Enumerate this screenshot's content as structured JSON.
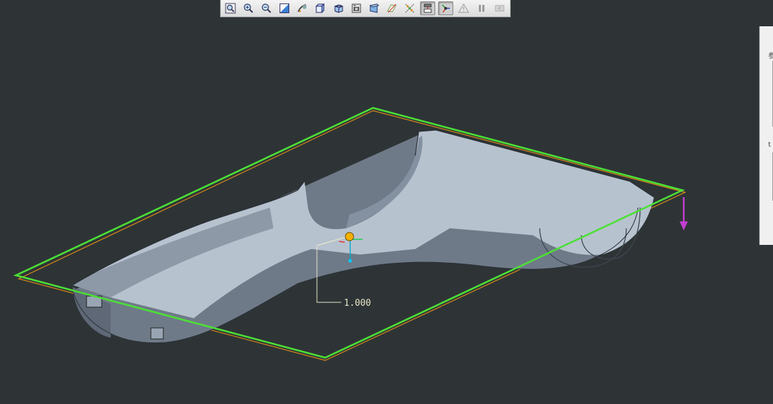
{
  "viewport": {
    "background": "#2e3436",
    "plane_outline_color": "#4ce036",
    "plane_edge_color": "#d98a1a",
    "model_color": "#a8b3c2",
    "direction_arrow_color": "#c23fd0"
  },
  "dimension": {
    "value": "1.000"
  },
  "toolbar": {
    "buttons": [
      {
        "icon": "zoom-fit-icon",
        "pressed": false
      },
      {
        "icon": "zoom-in-icon",
        "pressed": false
      },
      {
        "icon": "zoom-out-icon",
        "pressed": false
      },
      {
        "icon": "repaint-icon",
        "pressed": false
      },
      {
        "icon": "orient-mode-icon",
        "pressed": false
      },
      {
        "icon": "saved-views-icon",
        "pressed": false
      },
      {
        "icon": "display-style-icon",
        "pressed": false
      },
      {
        "icon": "view-manager-icon",
        "pressed": false
      },
      {
        "icon": "perspective-icon",
        "pressed": false
      },
      {
        "icon": "datum-planes-icon",
        "pressed": false
      },
      {
        "icon": "datum-points-icon",
        "pressed": false
      },
      {
        "icon": "annotation-display-icon",
        "pressed": true
      },
      {
        "icon": "spin-center-icon",
        "pressed": true
      },
      {
        "icon": "regenerate-warning-icon",
        "pressed": false
      },
      {
        "icon": "pause-icon",
        "pressed": false
      },
      {
        "icon": "exit-icon",
        "pressed": false
      }
    ]
  },
  "right_panel": {
    "glyph_top": "参",
    "glyph_bottom": "t"
  }
}
